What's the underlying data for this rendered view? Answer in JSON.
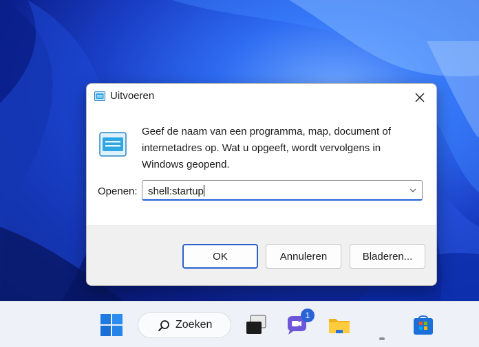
{
  "dialog": {
    "title": "Uitvoeren",
    "description": "Geef de naam van een programma, map, document of internetadres op. Wat u opgeeft, wordt vervolgens in Windows geopend.",
    "open_label": "Openen:",
    "open_value": "shell:startup",
    "buttons": {
      "ok": "OK",
      "cancel": "Annuleren",
      "browse": "Bladeren..."
    }
  },
  "taskbar": {
    "search_label": "Zoeken",
    "chat_badge_count": "1",
    "icons": [
      "windows-start-icon",
      "search-icon",
      "task-view-icon",
      "chat-icon",
      "file-explorer-icon",
      "microsoft-store-icon"
    ]
  },
  "colors": {
    "accent": "#2a62c9",
    "wallpaper": "#1a3fc7"
  }
}
